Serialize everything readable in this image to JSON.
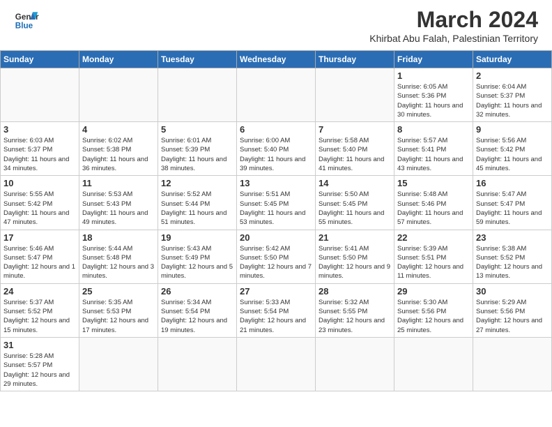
{
  "header": {
    "logo_line1": "General",
    "logo_line2": "Blue",
    "title": "March 2024",
    "subtitle": "Khirbat Abu Falah, Palestinian Territory"
  },
  "weekdays": [
    "Sunday",
    "Monday",
    "Tuesday",
    "Wednesday",
    "Thursday",
    "Friday",
    "Saturday"
  ],
  "weeks": [
    [
      {
        "day": "",
        "info": ""
      },
      {
        "day": "",
        "info": ""
      },
      {
        "day": "",
        "info": ""
      },
      {
        "day": "",
        "info": ""
      },
      {
        "day": "",
        "info": ""
      },
      {
        "day": "1",
        "info": "Sunrise: 6:05 AM\nSunset: 5:36 PM\nDaylight: 11 hours\nand 30 minutes."
      },
      {
        "day": "2",
        "info": "Sunrise: 6:04 AM\nSunset: 5:37 PM\nDaylight: 11 hours\nand 32 minutes."
      }
    ],
    [
      {
        "day": "3",
        "info": "Sunrise: 6:03 AM\nSunset: 5:37 PM\nDaylight: 11 hours\nand 34 minutes."
      },
      {
        "day": "4",
        "info": "Sunrise: 6:02 AM\nSunset: 5:38 PM\nDaylight: 11 hours\nand 36 minutes."
      },
      {
        "day": "5",
        "info": "Sunrise: 6:01 AM\nSunset: 5:39 PM\nDaylight: 11 hours\nand 38 minutes."
      },
      {
        "day": "6",
        "info": "Sunrise: 6:00 AM\nSunset: 5:40 PM\nDaylight: 11 hours\nand 39 minutes."
      },
      {
        "day": "7",
        "info": "Sunrise: 5:58 AM\nSunset: 5:40 PM\nDaylight: 11 hours\nand 41 minutes."
      },
      {
        "day": "8",
        "info": "Sunrise: 5:57 AM\nSunset: 5:41 PM\nDaylight: 11 hours\nand 43 minutes."
      },
      {
        "day": "9",
        "info": "Sunrise: 5:56 AM\nSunset: 5:42 PM\nDaylight: 11 hours\nand 45 minutes."
      }
    ],
    [
      {
        "day": "10",
        "info": "Sunrise: 5:55 AM\nSunset: 5:42 PM\nDaylight: 11 hours\nand 47 minutes."
      },
      {
        "day": "11",
        "info": "Sunrise: 5:53 AM\nSunset: 5:43 PM\nDaylight: 11 hours\nand 49 minutes."
      },
      {
        "day": "12",
        "info": "Sunrise: 5:52 AM\nSunset: 5:44 PM\nDaylight: 11 hours\nand 51 minutes."
      },
      {
        "day": "13",
        "info": "Sunrise: 5:51 AM\nSunset: 5:45 PM\nDaylight: 11 hours\nand 53 minutes."
      },
      {
        "day": "14",
        "info": "Sunrise: 5:50 AM\nSunset: 5:45 PM\nDaylight: 11 hours\nand 55 minutes."
      },
      {
        "day": "15",
        "info": "Sunrise: 5:48 AM\nSunset: 5:46 PM\nDaylight: 11 hours\nand 57 minutes."
      },
      {
        "day": "16",
        "info": "Sunrise: 5:47 AM\nSunset: 5:47 PM\nDaylight: 11 hours\nand 59 minutes."
      }
    ],
    [
      {
        "day": "17",
        "info": "Sunrise: 5:46 AM\nSunset: 5:47 PM\nDaylight: 12 hours\nand 1 minute."
      },
      {
        "day": "18",
        "info": "Sunrise: 5:44 AM\nSunset: 5:48 PM\nDaylight: 12 hours\nand 3 minutes."
      },
      {
        "day": "19",
        "info": "Sunrise: 5:43 AM\nSunset: 5:49 PM\nDaylight: 12 hours\nand 5 minutes."
      },
      {
        "day": "20",
        "info": "Sunrise: 5:42 AM\nSunset: 5:50 PM\nDaylight: 12 hours\nand 7 minutes."
      },
      {
        "day": "21",
        "info": "Sunrise: 5:41 AM\nSunset: 5:50 PM\nDaylight: 12 hours\nand 9 minutes."
      },
      {
        "day": "22",
        "info": "Sunrise: 5:39 AM\nSunset: 5:51 PM\nDaylight: 12 hours\nand 11 minutes."
      },
      {
        "day": "23",
        "info": "Sunrise: 5:38 AM\nSunset: 5:52 PM\nDaylight: 12 hours\nand 13 minutes."
      }
    ],
    [
      {
        "day": "24",
        "info": "Sunrise: 5:37 AM\nSunset: 5:52 PM\nDaylight: 12 hours\nand 15 minutes."
      },
      {
        "day": "25",
        "info": "Sunrise: 5:35 AM\nSunset: 5:53 PM\nDaylight: 12 hours\nand 17 minutes."
      },
      {
        "day": "26",
        "info": "Sunrise: 5:34 AM\nSunset: 5:54 PM\nDaylight: 12 hours\nand 19 minutes."
      },
      {
        "day": "27",
        "info": "Sunrise: 5:33 AM\nSunset: 5:54 PM\nDaylight: 12 hours\nand 21 minutes."
      },
      {
        "day": "28",
        "info": "Sunrise: 5:32 AM\nSunset: 5:55 PM\nDaylight: 12 hours\nand 23 minutes."
      },
      {
        "day": "29",
        "info": "Sunrise: 5:30 AM\nSunset: 5:56 PM\nDaylight: 12 hours\nand 25 minutes."
      },
      {
        "day": "30",
        "info": "Sunrise: 5:29 AM\nSunset: 5:56 PM\nDaylight: 12 hours\nand 27 minutes."
      }
    ],
    [
      {
        "day": "31",
        "info": "Sunrise: 5:28 AM\nSunset: 5:57 PM\nDaylight: 12 hours\nand 29 minutes."
      },
      {
        "day": "",
        "info": ""
      },
      {
        "day": "",
        "info": ""
      },
      {
        "day": "",
        "info": ""
      },
      {
        "day": "",
        "info": ""
      },
      {
        "day": "",
        "info": ""
      },
      {
        "day": "",
        "info": ""
      }
    ]
  ]
}
